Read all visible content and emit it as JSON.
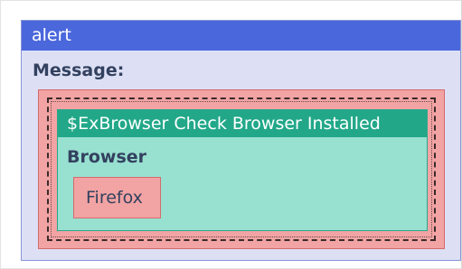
{
  "alert": {
    "title": "alert",
    "message_label": "Message:"
  },
  "check_browser": {
    "title": "$ExBrowser Check Browser Installed",
    "browser_label": "Browser",
    "browser_value": "Firefox"
  },
  "colors": {
    "alert_header": "#4a67dc",
    "alert_body": "#dde0f5",
    "slot_fill": "#f2a3a3",
    "block_header": "#22a889",
    "block_body": "#98e0d0"
  }
}
